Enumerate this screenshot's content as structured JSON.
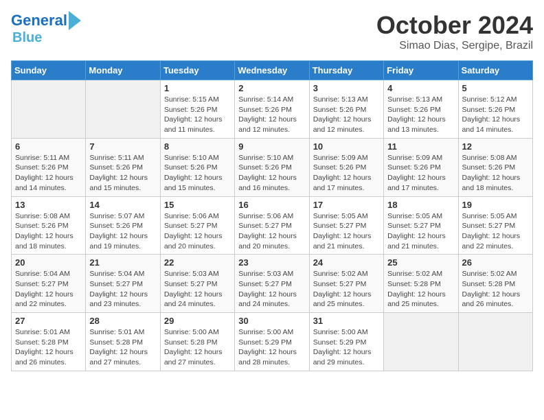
{
  "logo": {
    "line1": "General",
    "line2": "Blue"
  },
  "title": "October 2024",
  "subtitle": "Simao Dias, Sergipe, Brazil",
  "weekdays": [
    "Sunday",
    "Monday",
    "Tuesday",
    "Wednesday",
    "Thursday",
    "Friday",
    "Saturday"
  ],
  "weeks": [
    [
      {
        "day": "",
        "info": ""
      },
      {
        "day": "",
        "info": ""
      },
      {
        "day": "1",
        "info": "Sunrise: 5:15 AM\nSunset: 5:26 PM\nDaylight: 12 hours and 11 minutes."
      },
      {
        "day": "2",
        "info": "Sunrise: 5:14 AM\nSunset: 5:26 PM\nDaylight: 12 hours and 12 minutes."
      },
      {
        "day": "3",
        "info": "Sunrise: 5:13 AM\nSunset: 5:26 PM\nDaylight: 12 hours and 12 minutes."
      },
      {
        "day": "4",
        "info": "Sunrise: 5:13 AM\nSunset: 5:26 PM\nDaylight: 12 hours and 13 minutes."
      },
      {
        "day": "5",
        "info": "Sunrise: 5:12 AM\nSunset: 5:26 PM\nDaylight: 12 hours and 14 minutes."
      }
    ],
    [
      {
        "day": "6",
        "info": "Sunrise: 5:11 AM\nSunset: 5:26 PM\nDaylight: 12 hours and 14 minutes."
      },
      {
        "day": "7",
        "info": "Sunrise: 5:11 AM\nSunset: 5:26 PM\nDaylight: 12 hours and 15 minutes."
      },
      {
        "day": "8",
        "info": "Sunrise: 5:10 AM\nSunset: 5:26 PM\nDaylight: 12 hours and 15 minutes."
      },
      {
        "day": "9",
        "info": "Sunrise: 5:10 AM\nSunset: 5:26 PM\nDaylight: 12 hours and 16 minutes."
      },
      {
        "day": "10",
        "info": "Sunrise: 5:09 AM\nSunset: 5:26 PM\nDaylight: 12 hours and 17 minutes."
      },
      {
        "day": "11",
        "info": "Sunrise: 5:09 AM\nSunset: 5:26 PM\nDaylight: 12 hours and 17 minutes."
      },
      {
        "day": "12",
        "info": "Sunrise: 5:08 AM\nSunset: 5:26 PM\nDaylight: 12 hours and 18 minutes."
      }
    ],
    [
      {
        "day": "13",
        "info": "Sunrise: 5:08 AM\nSunset: 5:26 PM\nDaylight: 12 hours and 18 minutes."
      },
      {
        "day": "14",
        "info": "Sunrise: 5:07 AM\nSunset: 5:26 PM\nDaylight: 12 hours and 19 minutes."
      },
      {
        "day": "15",
        "info": "Sunrise: 5:06 AM\nSunset: 5:27 PM\nDaylight: 12 hours and 20 minutes."
      },
      {
        "day": "16",
        "info": "Sunrise: 5:06 AM\nSunset: 5:27 PM\nDaylight: 12 hours and 20 minutes."
      },
      {
        "day": "17",
        "info": "Sunrise: 5:05 AM\nSunset: 5:27 PM\nDaylight: 12 hours and 21 minutes."
      },
      {
        "day": "18",
        "info": "Sunrise: 5:05 AM\nSunset: 5:27 PM\nDaylight: 12 hours and 21 minutes."
      },
      {
        "day": "19",
        "info": "Sunrise: 5:05 AM\nSunset: 5:27 PM\nDaylight: 12 hours and 22 minutes."
      }
    ],
    [
      {
        "day": "20",
        "info": "Sunrise: 5:04 AM\nSunset: 5:27 PM\nDaylight: 12 hours and 22 minutes."
      },
      {
        "day": "21",
        "info": "Sunrise: 5:04 AM\nSunset: 5:27 PM\nDaylight: 12 hours and 23 minutes."
      },
      {
        "day": "22",
        "info": "Sunrise: 5:03 AM\nSunset: 5:27 PM\nDaylight: 12 hours and 24 minutes."
      },
      {
        "day": "23",
        "info": "Sunrise: 5:03 AM\nSunset: 5:27 PM\nDaylight: 12 hours and 24 minutes."
      },
      {
        "day": "24",
        "info": "Sunrise: 5:02 AM\nSunset: 5:27 PM\nDaylight: 12 hours and 25 minutes."
      },
      {
        "day": "25",
        "info": "Sunrise: 5:02 AM\nSunset: 5:28 PM\nDaylight: 12 hours and 25 minutes."
      },
      {
        "day": "26",
        "info": "Sunrise: 5:02 AM\nSunset: 5:28 PM\nDaylight: 12 hours and 26 minutes."
      }
    ],
    [
      {
        "day": "27",
        "info": "Sunrise: 5:01 AM\nSunset: 5:28 PM\nDaylight: 12 hours and 26 minutes."
      },
      {
        "day": "28",
        "info": "Sunrise: 5:01 AM\nSunset: 5:28 PM\nDaylight: 12 hours and 27 minutes."
      },
      {
        "day": "29",
        "info": "Sunrise: 5:00 AM\nSunset: 5:28 PM\nDaylight: 12 hours and 27 minutes."
      },
      {
        "day": "30",
        "info": "Sunrise: 5:00 AM\nSunset: 5:29 PM\nDaylight: 12 hours and 28 minutes."
      },
      {
        "day": "31",
        "info": "Sunrise: 5:00 AM\nSunset: 5:29 PM\nDaylight: 12 hours and 29 minutes."
      },
      {
        "day": "",
        "info": ""
      },
      {
        "day": "",
        "info": ""
      }
    ]
  ]
}
